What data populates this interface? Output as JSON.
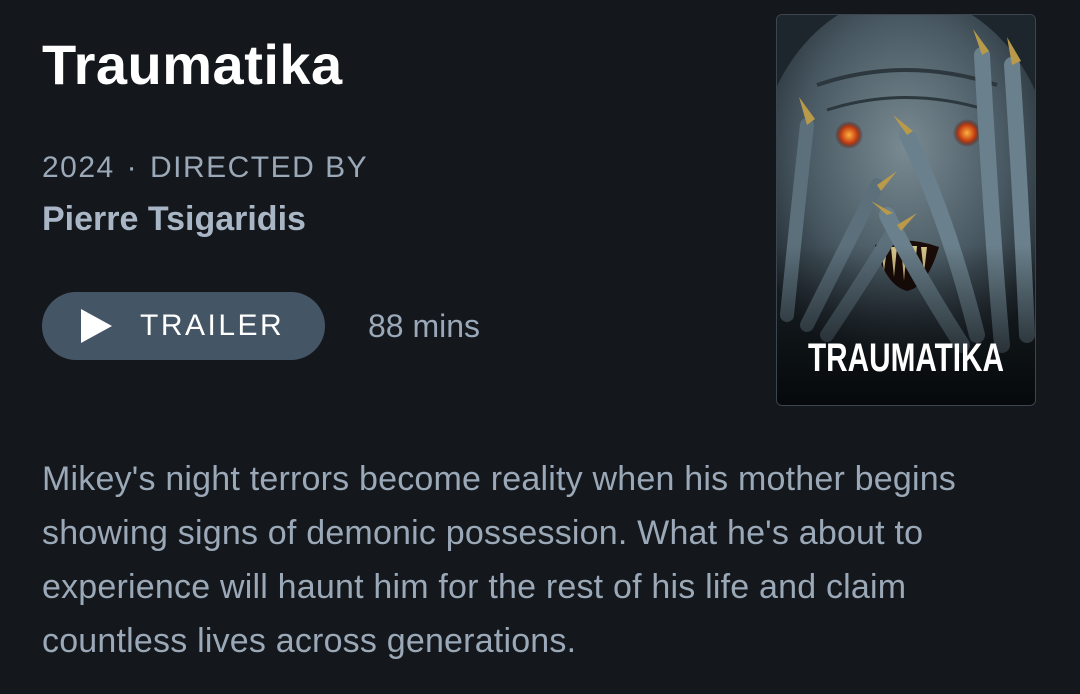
{
  "film": {
    "title": "Traumatika",
    "year": "2024",
    "separator": "·",
    "directed_by_label": "DIRECTED BY",
    "director": "Pierre Tsigaridis",
    "runtime": "88 mins",
    "synopsis": "Mikey's night terrors become reality when his mother begins showing signs of demonic possession. What he's about to experience will haunt him for the rest of his life and claim countless lives across generations."
  },
  "trailer_button": {
    "label": "TRAILER",
    "icon": "play-icon"
  },
  "poster": {
    "title_text": "TRAUMATIKA"
  },
  "colors": {
    "background": "#14181c",
    "muted_text": "#9aa8b8",
    "button_bg": "#445566"
  }
}
